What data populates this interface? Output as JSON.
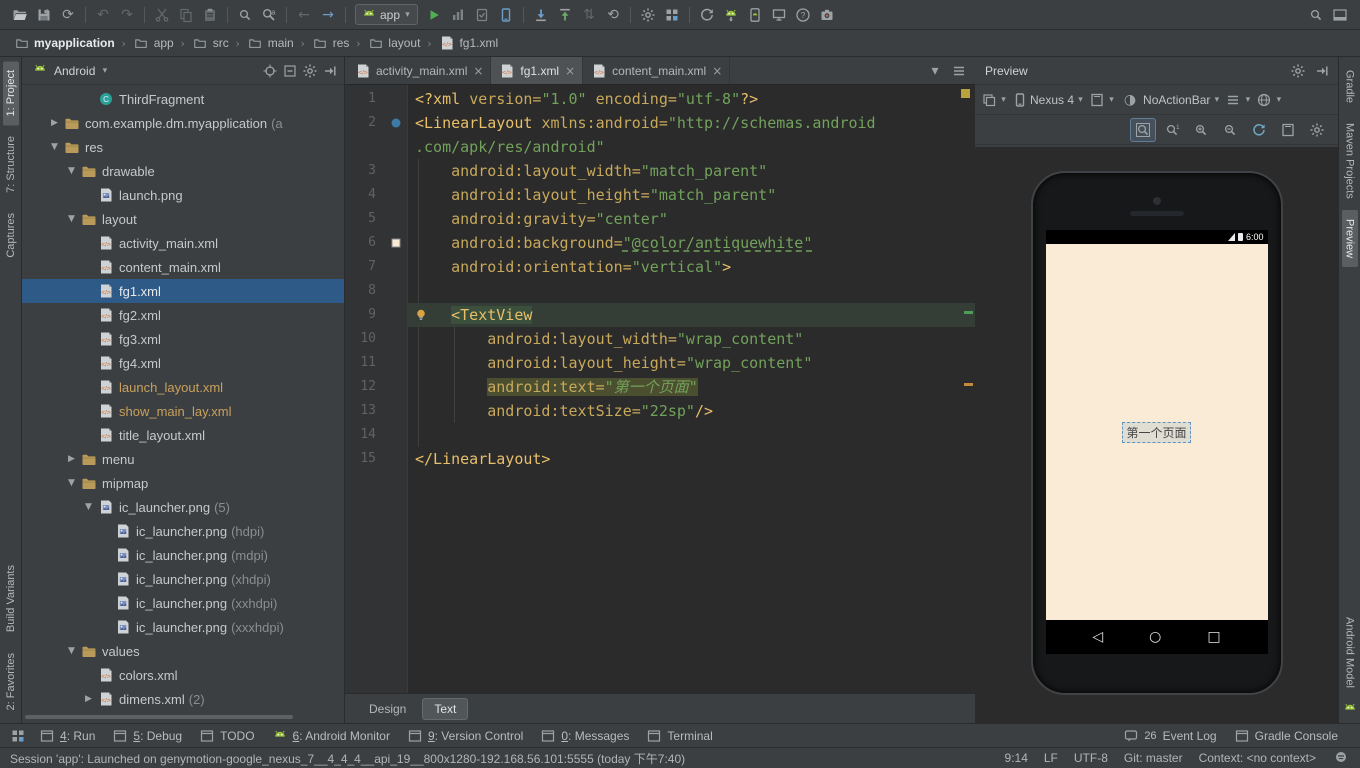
{
  "colors": {
    "selection_blue": "#2d5a87",
    "tag_gold": "#e8bf6a",
    "attr_gold": "#c8a95c",
    "string_green": "#6a8759",
    "android_green": "#97c13d",
    "preview_screen_bg": "#faebd7",
    "unversioned_file": "#c9a05c"
  },
  "toolbar": {
    "run_config": "app",
    "groups": [
      [
        "open-project",
        "save-all",
        "sync-files"
      ],
      [
        "undo",
        "redo"
      ],
      [
        "cut",
        "copy",
        "paste"
      ],
      [
        "find",
        "replace"
      ],
      [
        "back",
        "forward"
      ],
      [
        "run-config",
        "run",
        "profile",
        "coverage",
        "attach-device"
      ],
      [
        "vcs-update",
        "vcs-commit",
        "compare",
        "history"
      ],
      [
        "settings",
        "project-structure"
      ],
      [
        "gradle-sync",
        "sdk-manager",
        "avd-manager",
        "device-monitor",
        "help",
        "capture"
      ]
    ],
    "right_icons": [
      "search-everywhere",
      "panel-toggle"
    ]
  },
  "breadcrumbs": [
    {
      "label": "myapplication",
      "icon": "module-folder",
      "bold": true
    },
    {
      "label": "app",
      "icon": "crumb-folder"
    },
    {
      "label": "src",
      "icon": "crumb-folder"
    },
    {
      "label": "main",
      "icon": "crumb-folder"
    },
    {
      "label": "res",
      "icon": "crumb-folder"
    },
    {
      "label": "layout",
      "icon": "crumb-folder"
    },
    {
      "label": "fg1.xml",
      "icon": "xml-file"
    }
  ],
  "strips": {
    "left_top": [
      {
        "label": "1: Project",
        "active": true
      },
      {
        "label": "7: Structure"
      },
      {
        "label": "Captures"
      }
    ],
    "left_bottom": [
      {
        "label": "Build Variants"
      },
      {
        "label": "2: Favorites"
      }
    ],
    "right_top": [
      {
        "label": "Gradle"
      },
      {
        "label": "Maven Projects"
      },
      {
        "label": "Preview",
        "active": true
      }
    ],
    "right_bottom": [
      {
        "label": "Android Model"
      }
    ]
  },
  "project": {
    "title": "Android",
    "header_icons": [
      "target",
      "collapse-all",
      "settings",
      "hide-panel"
    ],
    "items": [
      {
        "label": "ThirdFragment",
        "icon": "class-c",
        "indent": 3
      },
      {
        "label": "com.example.dm.myapplication",
        "suffix": "(a",
        "icon": "package",
        "indent": 1,
        "arrow": "right"
      },
      {
        "label": "res",
        "icon": "folder",
        "indent": 1,
        "arrow": "down"
      },
      {
        "label": "drawable",
        "icon": "folder",
        "indent": 2,
        "arrow": "down"
      },
      {
        "label": "launch.png",
        "icon": "img-file",
        "indent": 3
      },
      {
        "label": "layout",
        "icon": "folder",
        "indent": 2,
        "arrow": "down"
      },
      {
        "label": "activity_main.xml",
        "icon": "xml-file",
        "indent": 3
      },
      {
        "label": "content_main.xml",
        "icon": "xml-file",
        "indent": 3
      },
      {
        "label": "fg1.xml",
        "icon": "xml-file",
        "indent": 3,
        "selected": true
      },
      {
        "label": "fg2.xml",
        "icon": "xml-file",
        "indent": 3
      },
      {
        "label": "fg3.xml",
        "icon": "xml-file",
        "indent": 3
      },
      {
        "label": "fg4.xml",
        "icon": "xml-file",
        "indent": 3
      },
      {
        "label": "launch_layout.xml",
        "icon": "xml-file",
        "indent": 3,
        "cls": "unversioned"
      },
      {
        "label": "show_main_lay.xml",
        "icon": "xml-file",
        "indent": 3,
        "cls": "unversioned"
      },
      {
        "label": "title_layout.xml",
        "icon": "xml-file",
        "indent": 3
      },
      {
        "label": "menu",
        "icon": "folder",
        "indent": 2,
        "arrow": "right"
      },
      {
        "label": "mipmap",
        "icon": "folder",
        "indent": 2,
        "arrow": "down"
      },
      {
        "label": "ic_launcher.png",
        "suffix": "(5)",
        "icon": "img-file",
        "indent": 3,
        "arrow": "down"
      },
      {
        "label": "ic_launcher.png",
        "suffix": "(hdpi)",
        "icon": "img-file",
        "indent": 4
      },
      {
        "label": "ic_launcher.png",
        "suffix": "(mdpi)",
        "icon": "img-file",
        "indent": 4
      },
      {
        "label": "ic_launcher.png",
        "suffix": "(xhdpi)",
        "icon": "img-file",
        "indent": 4
      },
      {
        "label": "ic_launcher.png",
        "suffix": "(xxhdpi)",
        "icon": "img-file",
        "indent": 4
      },
      {
        "label": "ic_launcher.png",
        "suffix": "(xxxhdpi)",
        "icon": "img-file",
        "indent": 4
      },
      {
        "label": "values",
        "icon": "folder",
        "indent": 2,
        "arrow": "down"
      },
      {
        "label": "colors.xml",
        "icon": "xml-file",
        "indent": 3
      },
      {
        "label": "dimens.xml",
        "suffix": "(2)",
        "icon": "xml-file",
        "indent": 3,
        "arrow": "right"
      }
    ]
  },
  "editor": {
    "tabs": [
      {
        "label": "activity_main.xml"
      },
      {
        "label": "fg1.xml",
        "active": true
      },
      {
        "label": "content_main.xml"
      }
    ],
    "tab_icons": [
      "chevron-down",
      "list-menu"
    ],
    "lines": [
      {
        "n": "1",
        "tokens": [
          [
            "<?xml ",
            "tag"
          ],
          [
            "version=",
            "attr"
          ],
          [
            "\"1.0\"",
            "str"
          ],
          [
            " ",
            ""
          ],
          [
            "encoding=",
            "attr"
          ],
          [
            "\"utf-8\"",
            "str"
          ],
          [
            "?>",
            "tag"
          ]
        ]
      },
      {
        "n": "2",
        "gutter": "circle",
        "tokens": [
          [
            "<LinearLayout ",
            "tag"
          ],
          [
            "xmlns:android=",
            "attr"
          ],
          [
            "\"http://schemas.android",
            "str"
          ]
        ]
      },
      {
        "n": "",
        "tokens": [
          [
            ".com/apk/res/android\"",
            "str"
          ]
        ]
      },
      {
        "n": "3",
        "tokens": [
          [
            "    ",
            ""
          ],
          [
            "android:layout_width=",
            "attr"
          ],
          [
            "\"match_parent\"",
            "str"
          ]
        ]
      },
      {
        "n": "4",
        "tokens": [
          [
            "    ",
            ""
          ],
          [
            "android:layout_height=",
            "attr"
          ],
          [
            "\"match_parent\"",
            "str"
          ]
        ]
      },
      {
        "n": "5",
        "tokens": [
          [
            "    ",
            ""
          ],
          [
            "android:gravity=",
            "attr"
          ],
          [
            "\"center\"",
            "str"
          ]
        ]
      },
      {
        "n": "6",
        "gutter": "color",
        "tokens": [
          [
            "    ",
            ""
          ],
          [
            "android:background=",
            "attr"
          ],
          [
            "\"@color/antiquewhite\"",
            "str link"
          ]
        ]
      },
      {
        "n": "7",
        "tokens": [
          [
            "    ",
            ""
          ],
          [
            "android:orientation=",
            "attr"
          ],
          [
            "\"vertical\"",
            "str"
          ],
          [
            ">",
            "tag"
          ]
        ]
      },
      {
        "n": "8",
        "tokens": []
      },
      {
        "n": "9",
        "gutter": "bulb",
        "caret": true,
        "tokens": [
          [
            "    ",
            ""
          ],
          [
            "<TextView",
            "tag hlg"
          ]
        ]
      },
      {
        "n": "10",
        "tokens": [
          [
            "        ",
            ""
          ],
          [
            "android:layout_width=",
            "attr"
          ],
          [
            "\"wrap_content\"",
            "str"
          ]
        ]
      },
      {
        "n": "11",
        "tokens": [
          [
            "        ",
            ""
          ],
          [
            "android:layout_height=",
            "attr"
          ],
          [
            "\"wrap_content\"",
            "str"
          ]
        ]
      },
      {
        "n": "12",
        "tokens": [
          [
            "        ",
            ""
          ],
          [
            "android:text=",
            "attr hly"
          ],
          [
            "\"第一个页面\"",
            "strcn hly"
          ]
        ]
      },
      {
        "n": "13",
        "tokens": [
          [
            "        ",
            ""
          ],
          [
            "android:textSize=",
            "attr"
          ],
          [
            "\"22sp\"",
            "str"
          ],
          [
            "/>",
            "tag"
          ]
        ]
      },
      {
        "n": "14",
        "tokens": []
      },
      {
        "n": "15",
        "tokens": [
          [
            "</LinearLayout>",
            "tag"
          ]
        ]
      }
    ],
    "bottom_tabs": [
      {
        "label": "Design"
      },
      {
        "label": "Text",
        "active": true
      }
    ]
  },
  "preview": {
    "title": "Preview",
    "header_icons": [
      "settings",
      "hide-panel"
    ],
    "toolbar": [
      {
        "icon": "layers"
      },
      {
        "icon": "device-phone",
        "label": "Nexus 4"
      },
      {
        "icon": "frame-screen"
      },
      {
        "icon": "theme-circle",
        "label": "NoActionBar"
      },
      {
        "icon": "list-menu"
      },
      {
        "icon": "globe"
      }
    ],
    "zoom": [
      {
        "icon": "mag-fit",
        "active": true
      },
      {
        "icon": "mag-100"
      },
      {
        "icon": "mag-plus"
      },
      {
        "icon": "mag-minus"
      },
      {
        "icon": "refresh-preview"
      },
      {
        "icon": "frame-screen"
      },
      {
        "icon": "settings"
      }
    ],
    "time": "6:00",
    "screen_text": "第一个页面"
  },
  "tool_buttons": {
    "left": [
      {
        "label": "4: Run",
        "icon": "window"
      },
      {
        "label": "5: Debug",
        "icon": "window"
      },
      {
        "label": "TODO",
        "icon": "window"
      },
      {
        "label": "6: Android Monitor",
        "icon": "android-head"
      },
      {
        "label": "9: Version Control",
        "icon": "window"
      },
      {
        "label": "0: Messages",
        "icon": "window"
      },
      {
        "label": "Terminal",
        "icon": "window"
      }
    ],
    "right": [
      {
        "label": "Event Log",
        "icon": "balloon",
        "badge": "26"
      },
      {
        "label": "Gradle Console",
        "icon": "window"
      }
    ]
  },
  "status": {
    "message": "Session 'app': Launched on genymotion-google_nexus_7__4_4_4__api_19__800x1280-192.168.56.101:5555 (today 下午7:40)",
    "caret": "9:14",
    "line_ending": "LF",
    "encoding": "UTF-8",
    "vcs": "Git: master",
    "context": "Context: <no context>"
  }
}
